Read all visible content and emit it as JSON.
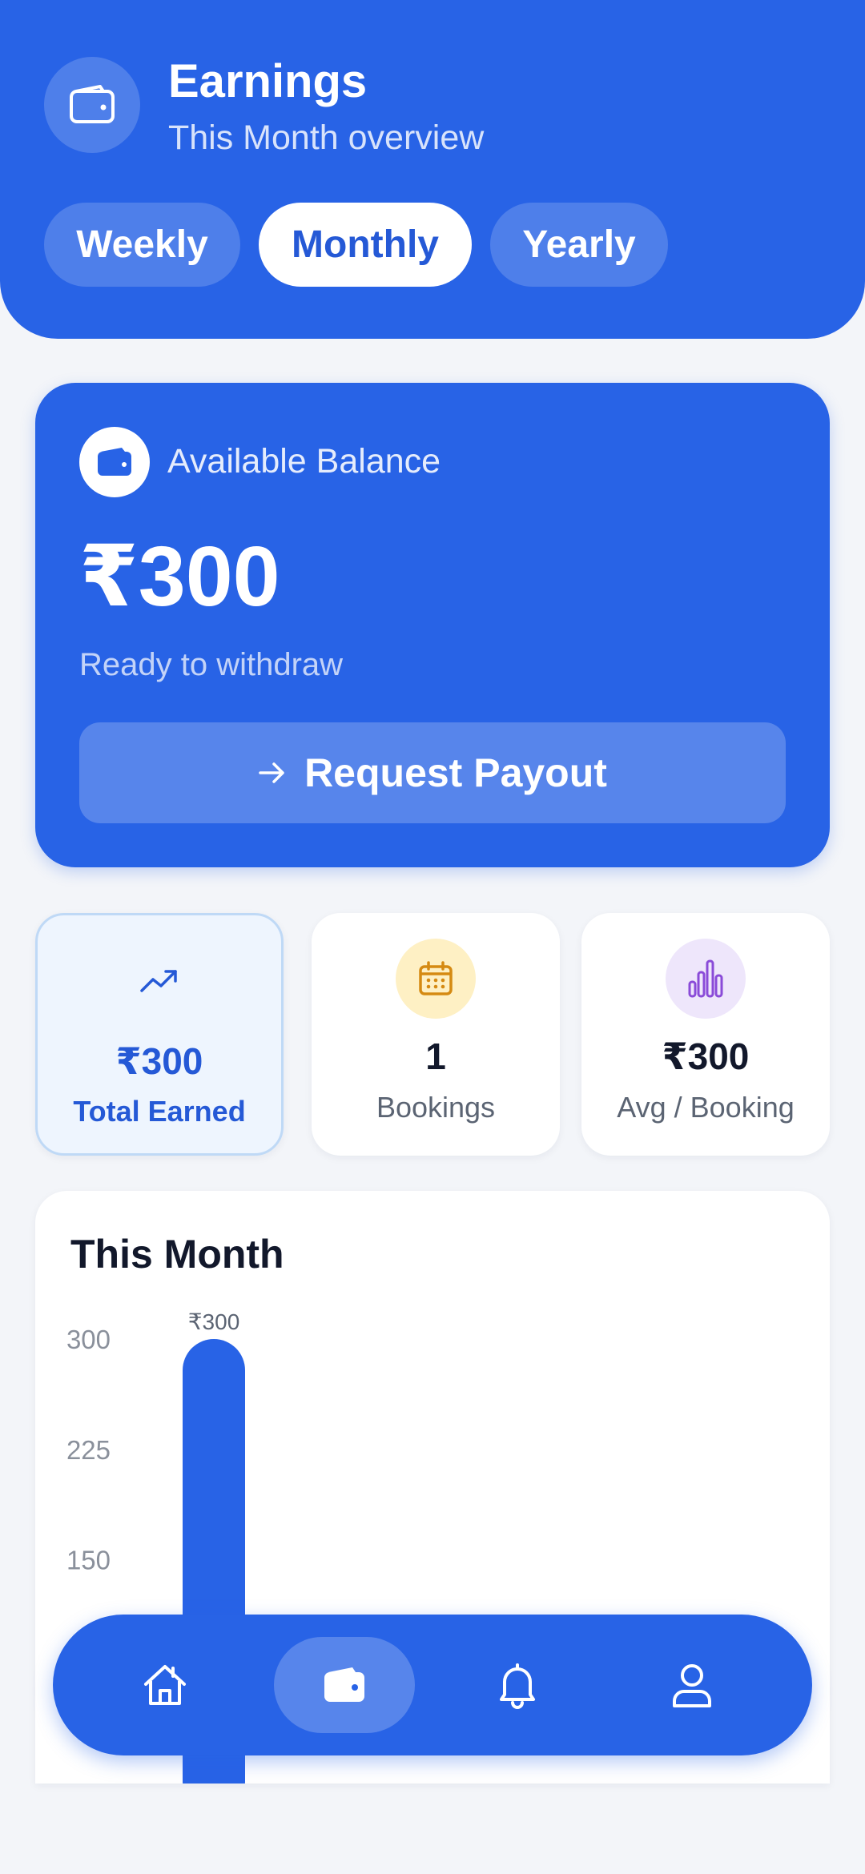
{
  "header": {
    "title": "Earnings",
    "subtitle": "This Month overview",
    "icon": "wallet-icon",
    "tabs": [
      {
        "label": "Weekly",
        "active": false
      },
      {
        "label": "Monthly",
        "active": true
      },
      {
        "label": "Yearly",
        "active": false
      }
    ]
  },
  "balance": {
    "label": "Available Balance",
    "amount": "₹300",
    "note": "Ready to withdraw",
    "button_label": "Request Payout",
    "icon": "wallet-icon"
  },
  "stats": [
    {
      "value": "₹300",
      "label": "Total Earned",
      "icon": "trend-up-icon",
      "highlighted": true
    },
    {
      "value": "1",
      "label": "Bookings",
      "icon": "calendar-icon",
      "icon_bg": "#FEF0C4",
      "icon_color": "#D58A12"
    },
    {
      "value": "₹300",
      "label": "Avg / Booking",
      "icon": "bar-chart-icon",
      "icon_bg": "#EEE6FB",
      "icon_color": "#8A4BD8"
    }
  ],
  "chart_data": {
    "type": "bar",
    "title": "This Month",
    "categories": [
      ""
    ],
    "values": [
      300
    ],
    "data_labels": [
      "₹300"
    ],
    "yticks": [
      300,
      225,
      150
    ],
    "ylim": [
      0,
      300
    ],
    "color": "#2863E6",
    "grid": false
  },
  "nav": {
    "items": [
      {
        "icon": "home-icon",
        "active": false
      },
      {
        "icon": "wallet-icon",
        "active": true
      },
      {
        "icon": "bell-icon",
        "active": false
      },
      {
        "icon": "profile-icon",
        "active": false
      }
    ]
  },
  "colors": {
    "primary": "#2863E6",
    "background": "#F3F5F9",
    "text_dark": "#12182B"
  }
}
